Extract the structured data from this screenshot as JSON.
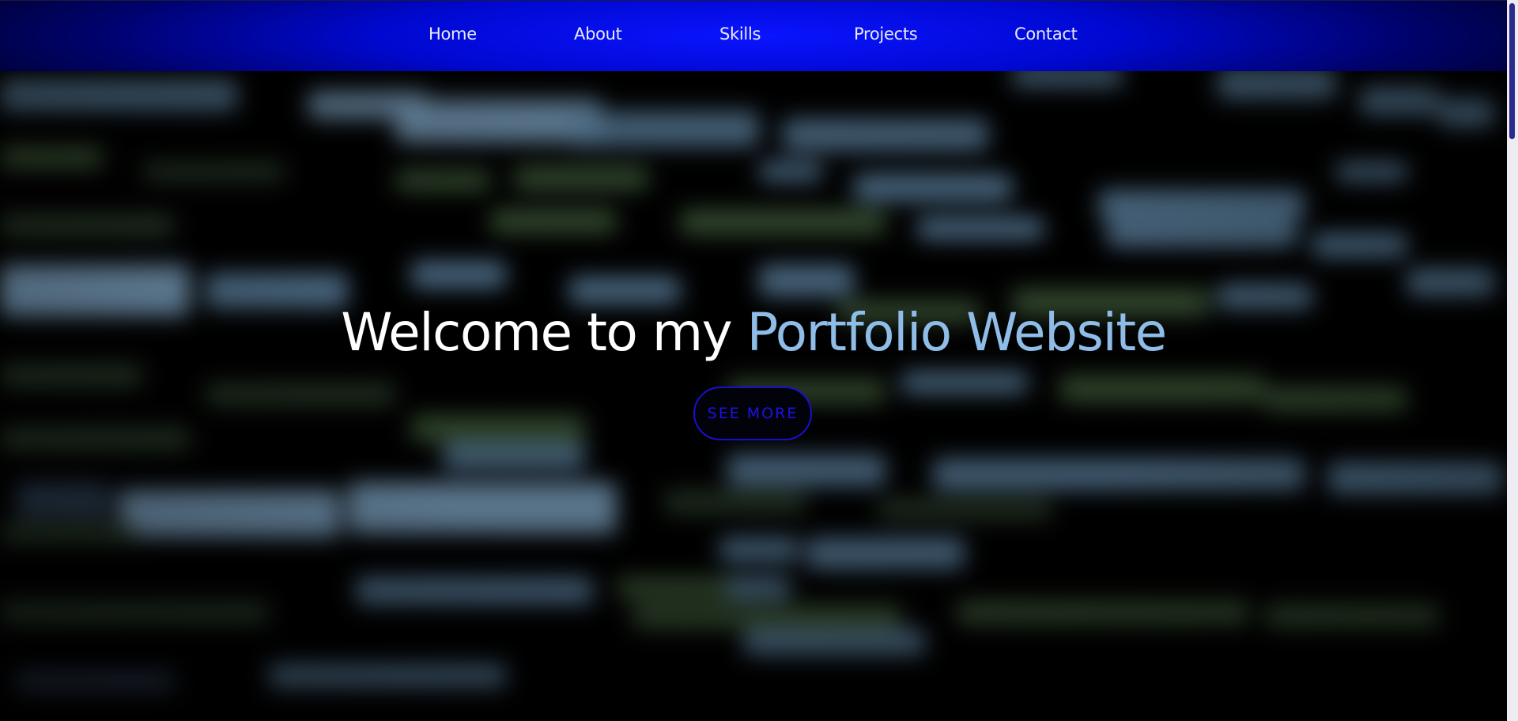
{
  "nav": {
    "items": [
      {
        "label": "Home"
      },
      {
        "label": "About"
      },
      {
        "label": "Skills"
      },
      {
        "label": "Projects"
      },
      {
        "label": "Contact"
      }
    ]
  },
  "hero": {
    "title_prefix": "Welcome to my ",
    "title_accent": "Portfolio Website",
    "cta_label": "SEE MORE"
  },
  "colors": {
    "nav_center": "#0a14ff",
    "nav_edge": "#00013a",
    "accent_text": "#8fbde8",
    "cta_border": "#1a0fd0",
    "cta_text": "#1d10e6",
    "scroll_thumb": "#2b2a8f"
  }
}
